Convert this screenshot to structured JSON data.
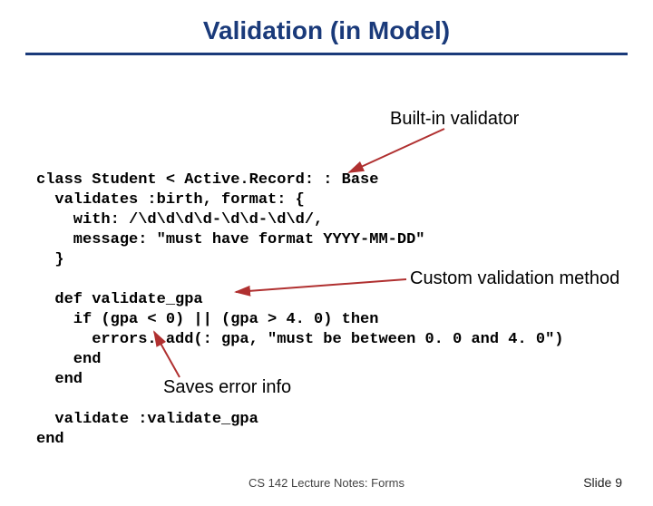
{
  "title": "Validation (in Model)",
  "annotations": {
    "builtin": "Built-in validator",
    "custom": "Custom validation method",
    "saves": "Saves error info"
  },
  "code": {
    "l1": "class Student < Active.Record: : Base",
    "l2": "  validates :birth, format: {",
    "l3": "    with: /\\d\\d\\d\\d-\\d\\d-\\d\\d/,",
    "l4": "    message: \"must have format YYYY-MM-DD\"",
    "l5": "  }",
    "l6": "",
    "l7": "  def validate_gpa",
    "l8": "    if (gpa < 0) || (gpa > 4. 0) then",
    "l9": "      errors. add(: gpa, \"must be between 0. 0 and 4. 0\")",
    "l10": "    end",
    "l11": "  end",
    "l12": "",
    "l13": "  validate :validate_gpa",
    "l14": "end"
  },
  "footer": {
    "center": "CS 142 Lecture Notes: Forms",
    "right": "Slide 9"
  },
  "colors": {
    "accent": "#1a3a7a",
    "arrow": "#b03030"
  }
}
